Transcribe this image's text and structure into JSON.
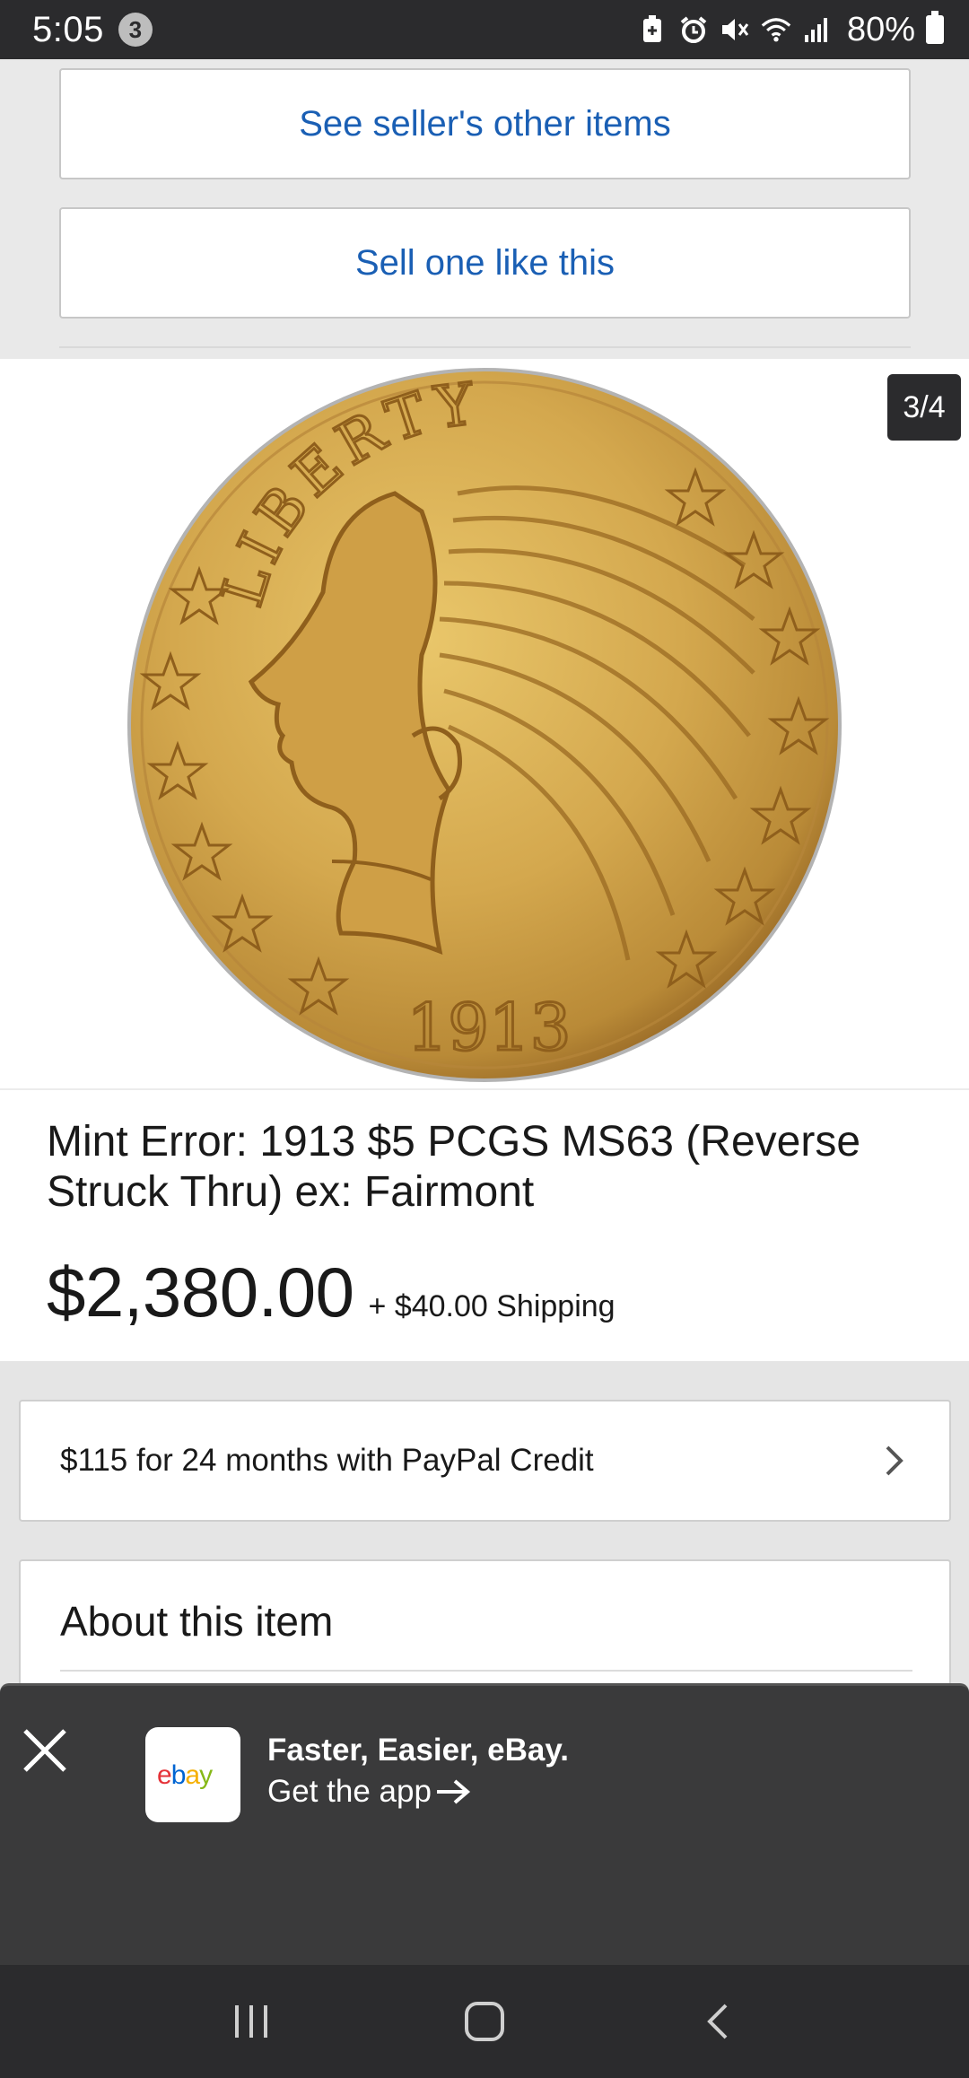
{
  "status_bar": {
    "time": "5:05",
    "notification_count": "3",
    "battery": "80%",
    "icons": [
      "battery-saver-icon",
      "alarm-icon",
      "mute-icon",
      "wifi-icon",
      "signal-icon",
      "battery-icon"
    ]
  },
  "seller": {
    "other_items_label": "See seller's other items",
    "sell_like_label": "Sell one like this"
  },
  "gallery": {
    "counter": "3/4",
    "coin_inscription": "LIBERTY",
    "coin_date": "1913"
  },
  "item": {
    "title": "Mint Error: 1913 $5 PCGS MS63 (Reverse Struck Thru) ex: Fairmont",
    "price": "$2,380.00",
    "shipping": "+ $40.00 Shipping"
  },
  "paypal": {
    "text": "$115 for 24 months with PayPal Credit"
  },
  "about": {
    "title": "About this item"
  },
  "app_banner": {
    "headline": "Faster, Easier, eBay.",
    "cta": "Get the app",
    "logo_text": "ebay",
    "logo_colors": [
      "#e53238",
      "#0064d2",
      "#f5af02",
      "#86b817"
    ]
  },
  "colors": {
    "link_blue": "#1a5fb4",
    "dark_bar": "#2b2b2d",
    "banner_bg": "#3a3a3b"
  }
}
